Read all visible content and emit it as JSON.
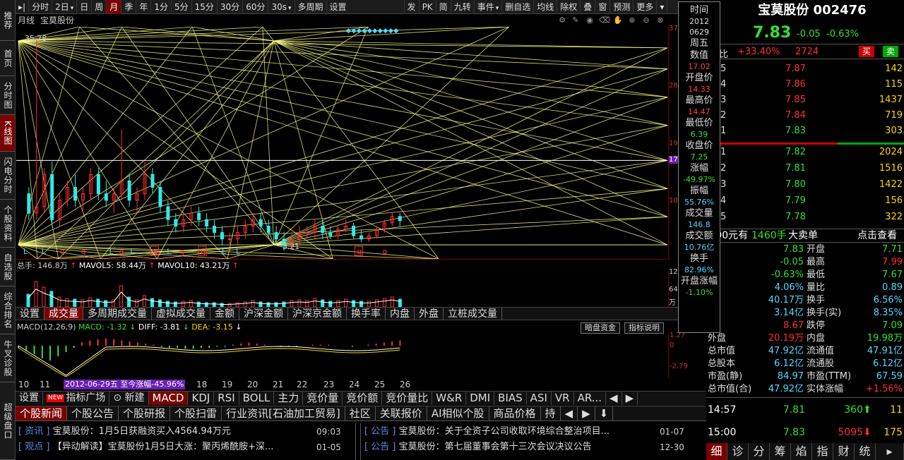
{
  "left_tabs": [
    "推荐",
    "首页",
    "分时图",
    "K线图",
    "闪电分时",
    "个股资料",
    "自选股",
    "综合排名",
    "牛叉诊股",
    "超级盘口"
  ],
  "toolbar": {
    "items": [
      "分时",
      "2日",
      "日",
      "周",
      "月",
      "季",
      "年",
      "1分",
      "5分",
      "15分",
      "30分",
      "60分",
      "30s",
      "多周期",
      "设置",
      "发",
      "PK",
      "简",
      "九转",
      "事件",
      "删自选",
      "均线",
      "除权",
      "叠",
      "窗",
      "预测",
      "更多"
    ],
    "active": "月"
  },
  "chart_header": {
    "period": "月线",
    "name": "宝莫股份"
  },
  "chart_icons": [
    "settings-icon",
    "pen-icon",
    "eye-icon",
    "trash-icon",
    "hand-icon",
    "zoom-in-icon",
    "zoom-out-icon"
  ],
  "main_chart": {
    "high_label": "35.78",
    "low_label": "3.21",
    "right_axis": [
      "37",
      "28",
      "19",
      "17",
      "10"
    ]
  },
  "candles": [
    {
      "o": 12,
      "h": 13,
      "l": 8,
      "c": 9
    },
    {
      "o": 9,
      "h": 35.78,
      "l": 8,
      "c": 10
    },
    {
      "o": 10,
      "h": 16,
      "l": 9,
      "c": 15
    },
    {
      "o": 15,
      "h": 17,
      "l": 7,
      "c": 8
    },
    {
      "o": 8,
      "h": 12,
      "l": 7,
      "c": 11
    },
    {
      "o": 11,
      "h": 14,
      "l": 10,
      "c": 13
    },
    {
      "o": 13,
      "h": 15,
      "l": 10,
      "c": 11
    },
    {
      "o": 11,
      "h": 13,
      "l": 9,
      "c": 12
    },
    {
      "o": 12,
      "h": 16,
      "l": 11,
      "c": 15
    },
    {
      "o": 15,
      "h": 16,
      "l": 11,
      "c": 12
    },
    {
      "o": 12,
      "h": 14,
      "l": 10,
      "c": 11
    },
    {
      "o": 11,
      "h": 13,
      "l": 9,
      "c": 12
    },
    {
      "o": 12,
      "h": 22,
      "l": 11,
      "c": 14
    },
    {
      "o": 14,
      "h": 15,
      "l": 10,
      "c": 11
    },
    {
      "o": 11,
      "h": 13,
      "l": 9,
      "c": 12
    },
    {
      "o": 12,
      "h": 17,
      "l": 11,
      "c": 15
    },
    {
      "o": 15,
      "h": 16,
      "l": 12,
      "c": 13
    },
    {
      "o": 13,
      "h": 14,
      "l": 9,
      "c": 10
    },
    {
      "o": 10,
      "h": 11,
      "l": 7,
      "c": 8
    },
    {
      "o": 8,
      "h": 9,
      "l": 6,
      "c": 7
    },
    {
      "o": 7,
      "h": 9,
      "l": 6,
      "c": 8
    },
    {
      "o": 8,
      "h": 10,
      "l": 7,
      "c": 9
    },
    {
      "o": 9,
      "h": 10,
      "l": 7,
      "c": 8
    },
    {
      "o": 8,
      "h": 9,
      "l": 6,
      "c": 7
    },
    {
      "o": 7,
      "h": 8,
      "l": 5,
      "c": 6
    },
    {
      "o": 6,
      "h": 7,
      "l": 4,
      "c": 5
    },
    {
      "o": 5,
      "h": 6,
      "l": 4,
      "c": 5
    },
    {
      "o": 5,
      "h": 7,
      "l": 4,
      "c": 6
    },
    {
      "o": 6,
      "h": 8,
      "l": 5,
      "c": 7
    },
    {
      "o": 7,
      "h": 9,
      "l": 6,
      "c": 8
    },
    {
      "o": 8,
      "h": 9,
      "l": 6,
      "c": 7
    },
    {
      "o": 7,
      "h": 8,
      "l": 5,
      "c": 6
    },
    {
      "o": 6,
      "h": 7,
      "l": 4,
      "c": 5
    },
    {
      "o": 5,
      "h": 6,
      "l": 3.21,
      "c": 4
    },
    {
      "o": 4,
      "h": 6,
      "l": 3.5,
      "c": 5
    },
    {
      "o": 5,
      "h": 7,
      "l": 4,
      "c": 6
    },
    {
      "o": 6,
      "h": 7,
      "l": 5,
      "c": 6
    },
    {
      "o": 6,
      "h": 8,
      "l": 5,
      "c": 7
    },
    {
      "o": 7,
      "h": 8,
      "l": 5,
      "c": 6
    },
    {
      "o": 6,
      "h": 7,
      "l": 5,
      "c": 5.5
    },
    {
      "o": 5.5,
      "h": 7,
      "l": 5,
      "c": 6.5
    },
    {
      "o": 6.5,
      "h": 8,
      "l": 6,
      "c": 7
    },
    {
      "o": 7,
      "h": 7.5,
      "l": 5,
      "c": 5.5
    },
    {
      "o": 5.5,
      "h": 6.5,
      "l": 4.5,
      "c": 5
    },
    {
      "o": 5,
      "h": 6,
      "l": 4.5,
      "c": 5.5
    },
    {
      "o": 5.5,
      "h": 7,
      "l": 5,
      "c": 6.5
    },
    {
      "o": 6.5,
      "h": 8,
      "l": 6,
      "c": 7.5
    },
    {
      "o": 7.5,
      "h": 9,
      "l": 7,
      "c": 8.5
    },
    {
      "o": 8.5,
      "h": 9,
      "l": 7,
      "c": 7.83
    }
  ],
  "volume": {
    "legend": {
      "total": "总手: 146.8万",
      "mavol5": "MAVOL5: 58.44万",
      "mavol10": "MAVOL10: 43.21万"
    },
    "axis": [
      "12",
      "64",
      "万"
    ]
  },
  "vol_tabs": [
    "设置",
    "成交量",
    "多周期成交量",
    "虚拟成交量",
    "金额",
    "沪深金额",
    "沪深京金额",
    "换手率",
    "内盘",
    "外盘",
    "立桩成交量"
  ],
  "vol_active": "成交量",
  "macd": {
    "legend": {
      "name": "MACD(12,26,9)",
      "macd": "MACD: -1.32",
      "diff": "DIFF: -3.81",
      "dea": "DEA: -3.15"
    },
    "axis": [
      "1.27",
      "0",
      "-2.79"
    ],
    "buttons": [
      "暗盘资金",
      "指标说明"
    ]
  },
  "xaxis": [
    "10",
    "11",
    "18",
    "19",
    "20",
    "21",
    "22",
    "23",
    "24",
    "25",
    "26"
  ],
  "range_label": "2012-06-29五 至今涨幅-45.96%",
  "ind_tabs": [
    "设置",
    "NEW",
    "指标广场",
    "新建",
    "MACD",
    "KDJ",
    "RSI",
    "BOLL",
    "主力",
    "竞价量",
    "竞价额",
    "竞价量比",
    "W&R",
    "DMI",
    "BIAS",
    "ASI",
    "VR",
    "AR..."
  ],
  "ind_active": "MACD",
  "news_tabs": [
    "个股新闻",
    "个股公告",
    "个股研报",
    "个股扫雷",
    "行业资讯[石油加工贸易]",
    "社区",
    "关联报价",
    "AI相似个股",
    "商品价格",
    "持"
  ],
  "news_active": "个股新闻",
  "news_left": [
    {
      "tag": "[ 资讯 ]",
      "text": "宝莫股份：1月5日获融资买入4564.94万元",
      "date": "09:03"
    },
    {
      "tag": "[ 观点 ]",
      "text": "【异动解读】宝莫股份1月5日大涨：聚丙烯酰胺+深...",
      "date": "01-05"
    }
  ],
  "news_right": [
    {
      "tag": "[ 公告 ]",
      "text": "宝莫股份：关于全资子公司收取环境综合整治项目...",
      "date": "01-07"
    },
    {
      "tag": "[ 公告 ]",
      "text": "宝莫股份：第七届董事会第十三次会议决议公告",
      "date": "12-30"
    }
  ],
  "info_panel": [
    {
      "label": "时间",
      "value": ""
    },
    {
      "label": "",
      "value": "2012"
    },
    {
      "label": "",
      "value": "0629"
    },
    {
      "label": "周五",
      "value": ""
    },
    {
      "label": "数值",
      "value": "17.02"
    },
    {
      "label": "开盘价",
      "value": "14.33"
    },
    {
      "label": "最高价",
      "value": "14.47"
    },
    {
      "label": "最低价",
      "value": "6.39"
    },
    {
      "label": "收盘价",
      "value": "7.25"
    },
    {
      "label": "涨幅",
      "value": "-49.97%"
    },
    {
      "label": "振幅",
      "value": "55.76%"
    },
    {
      "label": "成交量",
      "value": "146.8"
    },
    {
      "label": "成交额",
      "value": "10.76亿"
    },
    {
      "label": "换手",
      "value": "82.96%"
    },
    {
      "label": "开盘涨幅",
      "value": "-1.10%"
    }
  ],
  "right_panel": {
    "title": "宝莫股份 002476",
    "price": "7.83",
    "change": "-0.05",
    "pct": "-0.63%",
    "weibi_label": "比",
    "weibi": "+33.40%",
    "weicha": "2724",
    "buy_btn": "买",
    "sell_btn": "卖",
    "sell_levels": [
      {
        "lv": "5",
        "price": "7.87",
        "vol": "142"
      },
      {
        "lv": "4",
        "price": "7.86",
        "vol": "115"
      },
      {
        "lv": "3",
        "price": "7.85",
        "vol": "1437"
      },
      {
        "lv": "2",
        "price": "7.84",
        "vol": "719"
      },
      {
        "lv": "1",
        "price": "7.83",
        "vol": "303"
      }
    ],
    "buy_levels": [
      {
        "lv": "1",
        "price": "7.82",
        "vol": "2024"
      },
      {
        "lv": "2",
        "price": "7.81",
        "vol": "1516"
      },
      {
        "lv": "3",
        "price": "7.80",
        "vol": "1422"
      },
      {
        "lv": "4",
        "price": "7.79",
        "vol": "156"
      },
      {
        "lv": "5",
        "price": "7.78",
        "vol": "322"
      }
    ],
    "big_order": {
      "price": "7.90元有",
      "vol": "1460手",
      "label": "大卖单",
      "link": "点击查看"
    },
    "stats": [
      [
        "新",
        "7.83",
        "开盘",
        "7.71"
      ],
      [
        "跌",
        "-0.05",
        "最高",
        "7.99"
      ],
      [
        "幅",
        "-0.63%",
        "最低",
        "7.67"
      ],
      [
        "幅",
        "4.06%",
        "量比",
        "0.89"
      ],
      [
        "手",
        "40.17万",
        "换手",
        "6.56%"
      ],
      [
        "额",
        "3.14亿",
        "换手(实)",
        "8.35%"
      ],
      [
        "停",
        "8.67",
        "跌停",
        "7.09"
      ],
      [
        "外盘",
        "20.19万",
        "内盘",
        "19.98万"
      ],
      [
        "总市值",
        "47.92亿",
        "流通值",
        "47.91亿"
      ],
      [
        "总股本",
        "6.12亿",
        "流通股",
        "6.12亿"
      ],
      [
        "市盈(静)",
        "84.97",
        "市盈(TTM)",
        "67.59"
      ],
      [
        "总市值(合)",
        "47.92亿",
        "实体涨幅",
        "+1.56%"
      ]
    ],
    "ticks": [
      {
        "time": "14:57",
        "price": "7.81",
        "vol": "360",
        "n": "11"
      },
      {
        "time": "15:00",
        "price": "7.83",
        "vol": "5095",
        "n": "175"
      }
    ],
    "bottom_tabs": [
      "细",
      "诊",
      "分",
      "筹",
      "焰",
      "指",
      "财",
      "统"
    ]
  },
  "colors": {
    "up": "#ff3030",
    "down": "#33e033",
    "accent": "#7a0000",
    "line": "#ffff66"
  }
}
